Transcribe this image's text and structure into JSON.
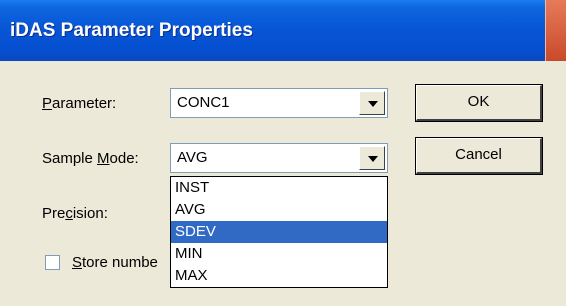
{
  "window": {
    "title": "iDAS Parameter Properties"
  },
  "parameter": {
    "label_accel": "P",
    "label_rest": "arameter:",
    "value": "CONC1"
  },
  "sample_mode": {
    "label_pre": "Sample ",
    "label_accel": "M",
    "label_rest": "ode:",
    "value": "AVG",
    "options": [
      "INST",
      "AVG",
      "SDEV",
      "MIN",
      "MAX"
    ],
    "highlighted": "SDEV"
  },
  "precision": {
    "label_pre": "Pre",
    "label_accel": "c",
    "label_rest": "ision:"
  },
  "store_samples": {
    "label_accel": "S",
    "label_rest": "tore numbe",
    "checked": false
  },
  "buttons": {
    "ok": "OK",
    "cancel": "Cancel"
  },
  "colors": {
    "titlebar": "#0550d0",
    "dialog_bg": "#ece9d8",
    "selection": "#316ac5"
  }
}
